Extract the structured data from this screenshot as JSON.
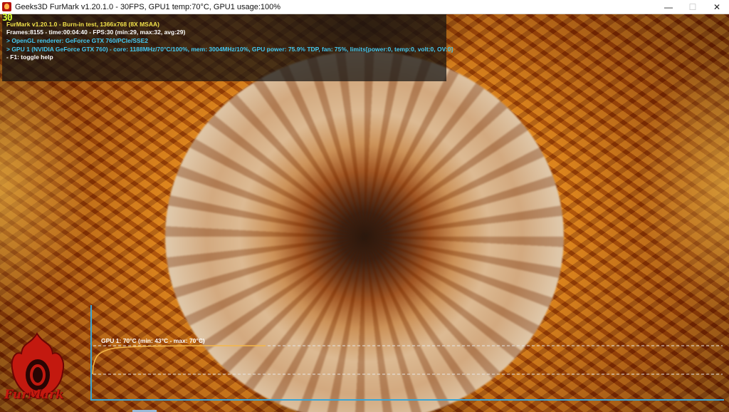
{
  "window": {
    "title": "Geeks3D FurMark v1.20.1.0 - 30FPS, GPU1 temp:70°C, GPU1 usage:100%",
    "icon": "furmark-app-icon",
    "controls": [
      "—",
      "☐",
      "✕"
    ]
  },
  "osd": {
    "fps_big": "30",
    "lines": [
      {
        "text": "FurMark v1.20.1.0 - Burn-in test, 1366x768 (8X MSAA)",
        "color": "#f2e24a"
      },
      {
        "text": "Frames:8155 - time:00:04:40 - FPS:30 (min:29, max:32, avg:29)",
        "color": "#ffffff"
      },
      {
        "text": "> OpenGL renderer: GeForce GTX 760/PCIe/SSE2",
        "color": "#44c8f0"
      },
      {
        "text": "> GPU 1 (NVIDIA GeForce GTX 760) - core: 1188MHz/70°C/100%, mem: 3004MHz/10%, GPU power: 75.9% TDP, fan: 75%, limits[power:0, temp:0, volt:0, OV:0]",
        "color": "#44c8f0"
      },
      {
        "text": "- F1: toggle help",
        "color": "#ffffff"
      }
    ]
  },
  "graph": {
    "label": "GPU 1: 70°C (min: 43°C - max: 70°C)",
    "line_color": "#f5b84a",
    "frame_color": "#3aa6d6",
    "temperature_current": 70,
    "temperature_min": 43,
    "temperature_max": 70
  },
  "logo": {
    "text": "FurMark",
    "color": "#c3190f"
  }
}
